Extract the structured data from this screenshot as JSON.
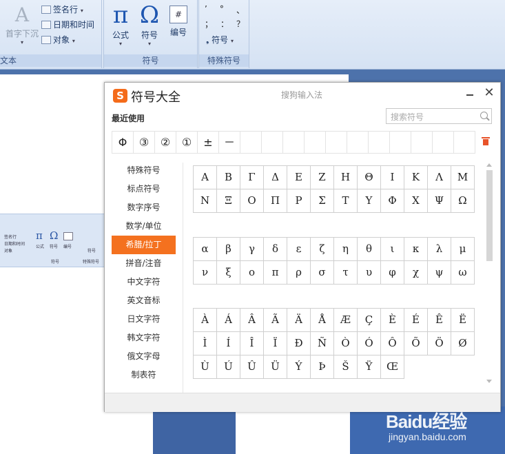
{
  "ribbon": {
    "text_group": {
      "label": "文本",
      "dropcap_label": "首字下沉",
      "signature_label": "签名行",
      "datetime_label": "日期和时间",
      "object_label": "对象"
    },
    "symbols_group": {
      "label": "符号",
      "formula_label": "公式",
      "symbol_label": "符号",
      "numbering_label": "编号",
      "formula_glyph": "π",
      "symbol_glyph": "Ω",
      "numbering_glyph": "#"
    },
    "special_group": {
      "label": "特殊符号",
      "punct_row1": [
        "’",
        "°",
        "、"
      ],
      "punct_row2": [
        "；",
        "：",
        "？"
      ],
      "symbol_label": "符号"
    }
  },
  "dialog": {
    "logo_letter": "S",
    "title": "符号大全",
    "ime_name": "搜狗输入法",
    "close_glyph": "✕",
    "recent_label": "最近使用",
    "search_placeholder": "搜索符号",
    "recent_symbols": [
      "Φ",
      "③",
      "②",
      "①",
      "±",
      "－",
      "",
      "",
      "",
      "",
      "",
      "",
      "",
      "",
      "",
      "",
      ""
    ],
    "categories": [
      {
        "label": "特殊符号",
        "active": false
      },
      {
        "label": "标点符号",
        "active": false
      },
      {
        "label": "数字序号",
        "active": false
      },
      {
        "label": "数学/单位",
        "active": false
      },
      {
        "label": "希腊/拉丁",
        "active": true
      },
      {
        "label": "拼音/注音",
        "active": false
      },
      {
        "label": "中文字符",
        "active": false
      },
      {
        "label": "英文音标",
        "active": false
      },
      {
        "label": "日文字符",
        "active": false
      },
      {
        "label": "韩文字符",
        "active": false
      },
      {
        "label": "俄文字母",
        "active": false
      },
      {
        "label": "制表符",
        "active": false
      }
    ],
    "symbol_blocks": [
      {
        "symbols": [
          "Α",
          "Β",
          "Γ",
          "Δ",
          "Ε",
          "Ζ",
          "Η",
          "Θ",
          "Ι",
          "Κ",
          "Λ",
          "Μ",
          "Ν",
          "Ξ",
          "Ο",
          "Π",
          "Ρ",
          "Σ",
          "Τ",
          "Υ",
          "Φ",
          "Χ",
          "Ψ",
          "Ω"
        ]
      },
      {
        "symbols": [
          "α",
          "β",
          "γ",
          "δ",
          "ε",
          "ζ",
          "η",
          "θ",
          "ι",
          "κ",
          "λ",
          "μ",
          "ν",
          "ξ",
          "ο",
          "π",
          "ρ",
          "σ",
          "τ",
          "υ",
          "φ",
          "χ",
          "ψ",
          "ω"
        ]
      },
      {
        "symbols": [
          "À",
          "Á",
          "Â",
          "Ã",
          "Ä",
          "Å",
          "Æ",
          "Ç",
          "È",
          "É",
          "Ê",
          "Ë",
          "Ì",
          "Í",
          "Î",
          "Ï",
          "Ð",
          "Ñ",
          "Ò",
          "Ó",
          "Ô",
          "Õ",
          "Ö",
          "Ø",
          "Ù",
          "Ú",
          "Û",
          "Ü",
          "Ý",
          "Þ",
          "Š",
          "Ÿ",
          "Œ"
        ]
      }
    ]
  },
  "background_mini_ribbon": {
    "signature_label": "签名行",
    "datetime_label": "日期和时间",
    "object_label": "对象",
    "formula_label": "公式",
    "symbol_label": "符号",
    "numbering_label": "编号",
    "group_label_symbols": "符号",
    "group_label_special": "特殊符号",
    "special_symbol_label": "符号"
  },
  "watermark": {
    "logo_text": "Baidu经验",
    "url": "jingyan.baidu.com"
  }
}
